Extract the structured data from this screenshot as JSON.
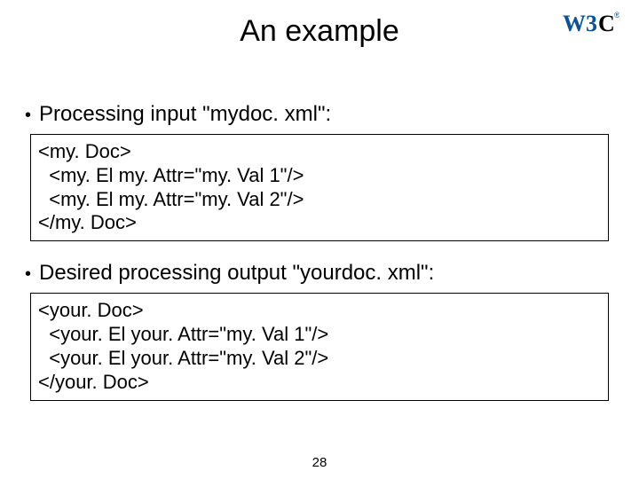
{
  "title": "An example",
  "logo_label": "W3C",
  "bullets": [
    "Processing input \"mydoc. xml\":",
    "Desired processing output \"yourdoc. xml\":"
  ],
  "codeblocks": [
    "<my. Doc>\n  <my. El my. Attr=\"my. Val 1\"/>\n  <my. El my. Attr=\"my. Val 2\"/>\n</my. Doc>",
    "<your. Doc>\n  <your. El your. Attr=\"my. Val 1\"/>\n  <your. El your. Attr=\"my. Val 2\"/>\n</your. Doc>"
  ],
  "page_number": "28"
}
